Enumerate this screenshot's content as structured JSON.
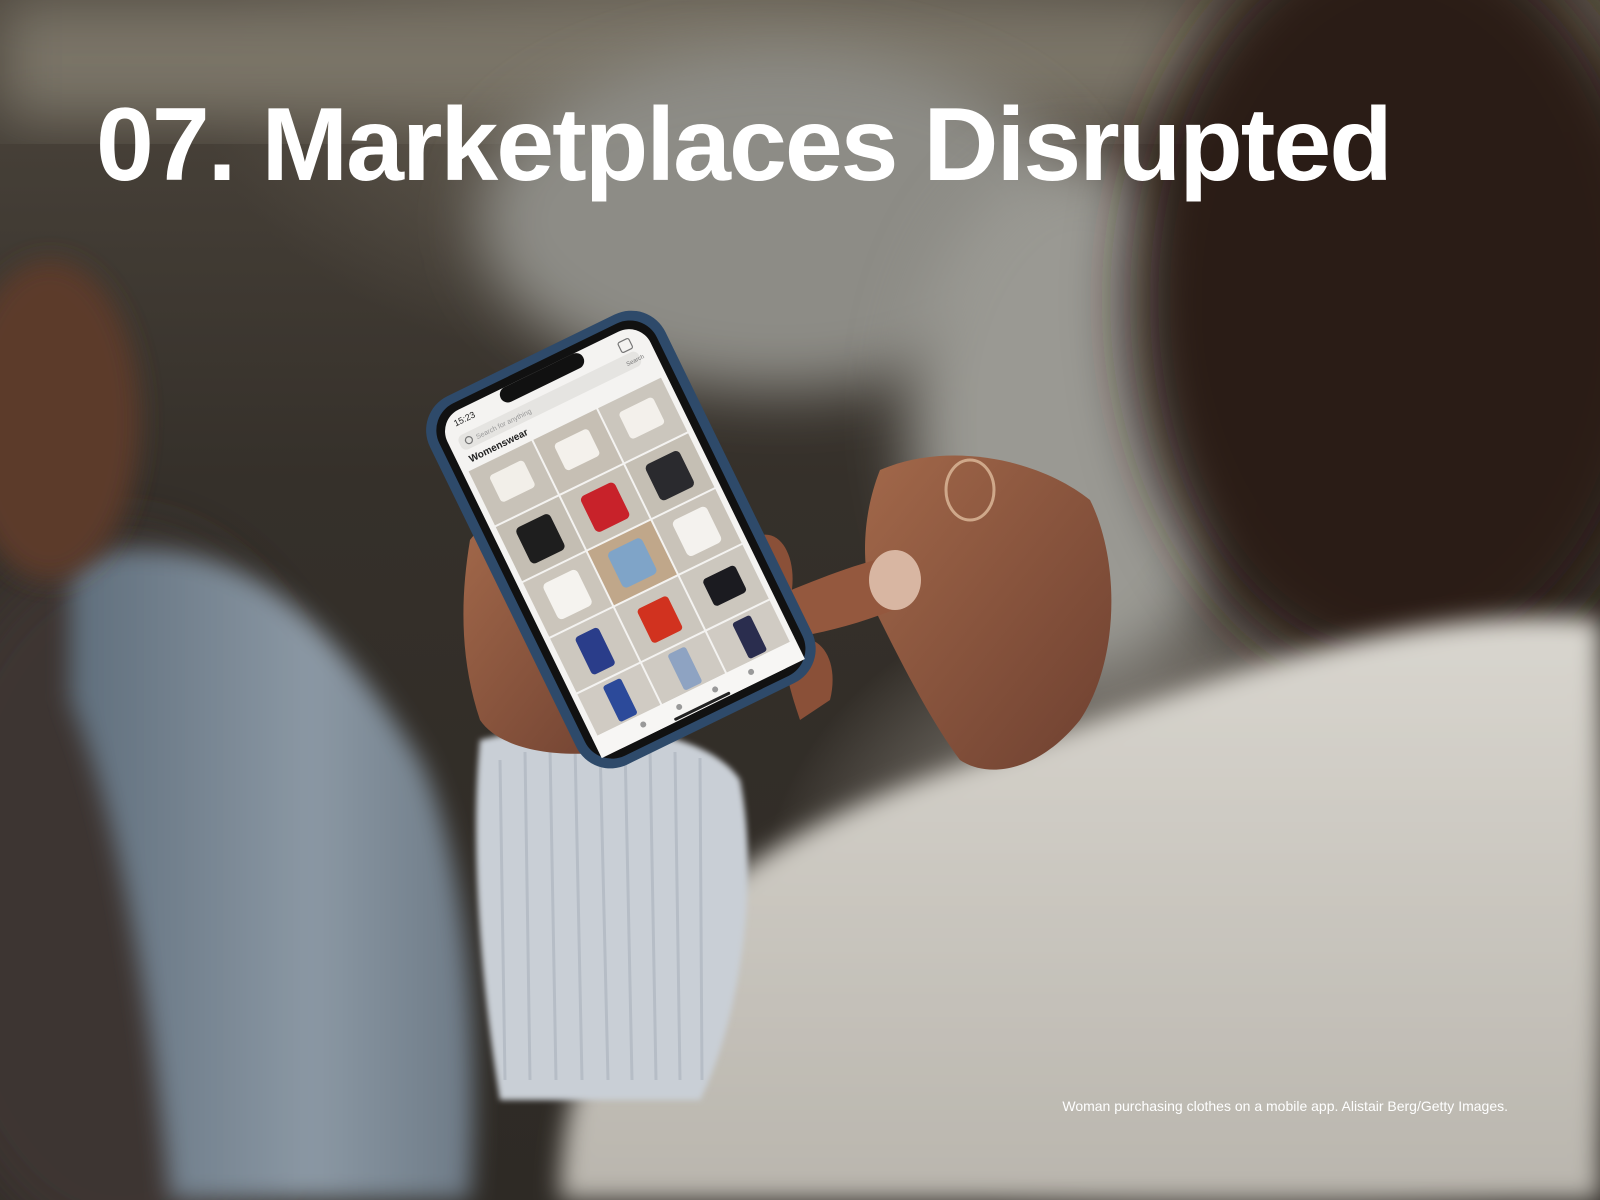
{
  "slide": {
    "title": "07. Marketplaces Disrupted",
    "caption": "Woman purchasing clothes on a mobile app. Alistair Berg/Getty Images."
  },
  "phone_screen": {
    "time": "15:23",
    "search_placeholder": "Search for anything",
    "search_action": "Search",
    "section_title": "Womenswear"
  },
  "colors": {
    "title": "#ffffff",
    "caption": "#ffffff",
    "phone_case": "#2e4a6a"
  },
  "icons": [
    "search-icon",
    "bag-icon",
    "home-icon",
    "heart-icon",
    "cart-icon",
    "menu-icon"
  ]
}
